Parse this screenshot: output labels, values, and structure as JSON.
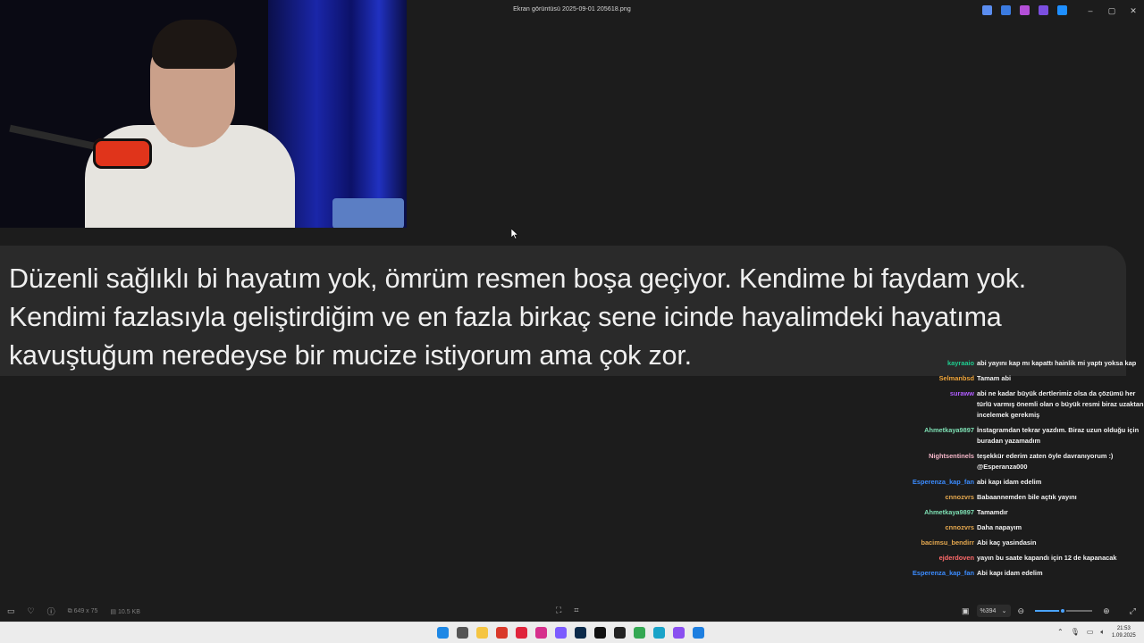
{
  "window": {
    "title": "Ekran görüntüsü 2025-09-01 205618.png",
    "controls": {
      "minimize": "–",
      "maximize": "▢",
      "close": "✕"
    }
  },
  "header_apps": [
    {
      "name": "copilot-icon",
      "color": "#5b8def"
    },
    {
      "name": "edit-icon",
      "color": "#3b7be0"
    },
    {
      "name": "designer-icon",
      "color": "#b44fd8"
    },
    {
      "name": "clipchamp-icon",
      "color": "#7b4fe0"
    },
    {
      "name": "onedrive-icon",
      "color": "#1e8fff"
    }
  ],
  "caption": {
    "text": "Düzenli sağlıklı bi hayatım yok, ömrüm resmen boşa geçiyor. Kendime bi faydam yok. Kendimi fazlasıyla geliştirdiğim ve en fazla birkaç sene icinde hayalimdeki hayatıma kavuştuğum neredeyse bir mucize istiyorum ama çok zor."
  },
  "chat": [
    {
      "user": "kayraaio",
      "color": "#1fcc8f",
      "text": "abi yayını kap mı kapattı hainlik mi yaptı yoksa kap"
    },
    {
      "user": "Selmanbsd",
      "color": "#f0a63c",
      "text": "Tamam abi"
    },
    {
      "user": "suraww",
      "color": "#b05cff",
      "text": "abi ne kadar büyük dertlerimiz olsa da çözümü her türlü varmış önemli olan o büyük resmi biraz uzaktan incelemek gerekmiş"
    },
    {
      "user": "Ahmetkaya9897",
      "color": "#7ee0b4",
      "text": "İnstagramdan tekrar yazdım. Biraz uzun olduğu için buradan yazamadım"
    },
    {
      "user": "Nightsentinels",
      "color": "#f4b6c8",
      "text": "teşekkür ederim zaten öyle davranıyorum :) @Esperanza000"
    },
    {
      "user": "Esperenza_kap_fan",
      "color": "#3b8cff",
      "text": "abi kapı idam edelim"
    },
    {
      "user": "cnnozvrs",
      "color": "#e5a84f",
      "text": "Babaannemden bile açtık yayını"
    },
    {
      "user": "Ahmetkaya9897",
      "color": "#7ee0b4",
      "text": "Tamamdır"
    },
    {
      "user": "cnnozvrs",
      "color": "#e5a84f",
      "text": "Daha napayım"
    },
    {
      "user": "bacimsu_bendirr",
      "color": "#e5a84f",
      "text": "Abi kaç yasindasin"
    },
    {
      "user": "ejderdoven",
      "color": "#ff6a6a",
      "text": "yayın bu saate kapandı için 12 de kapanacak"
    },
    {
      "user": "Esperenza_kap_fan",
      "color": "#3b8cff",
      "text": "Abi kapı idam edelim"
    }
  ],
  "viewer": {
    "dimensions": "649 x 75",
    "filesize": "10.5 KB",
    "zoom": "%394",
    "zoom_fraction": 0.48
  },
  "taskbar": {
    "apps": [
      {
        "name": "start-icon",
        "color": "#1e88e5"
      },
      {
        "name": "task-view-icon",
        "color": "#555555"
      },
      {
        "name": "file-explorer-icon",
        "color": "#f5c542"
      },
      {
        "name": "app-red-icon",
        "color": "#d9392a"
      },
      {
        "name": "opera-icon",
        "color": "#e0243c"
      },
      {
        "name": "instagram-icon",
        "color": "#d6308c"
      },
      {
        "name": "messenger-icon",
        "color": "#7c5cff"
      },
      {
        "name": "photoshop-icon",
        "color": "#0b2a4a"
      },
      {
        "name": "tiktok-icon",
        "color": "#111111"
      },
      {
        "name": "capcut-icon",
        "color": "#222222"
      },
      {
        "name": "chrome-icon",
        "color": "#34a853"
      },
      {
        "name": "snipping-icon",
        "color": "#1aa3c8"
      },
      {
        "name": "app-purple-icon",
        "color": "#8a4ff0"
      },
      {
        "name": "photos-icon",
        "color": "#1e7fe0"
      }
    ],
    "time": "21:53",
    "date": "1.09.2025"
  }
}
